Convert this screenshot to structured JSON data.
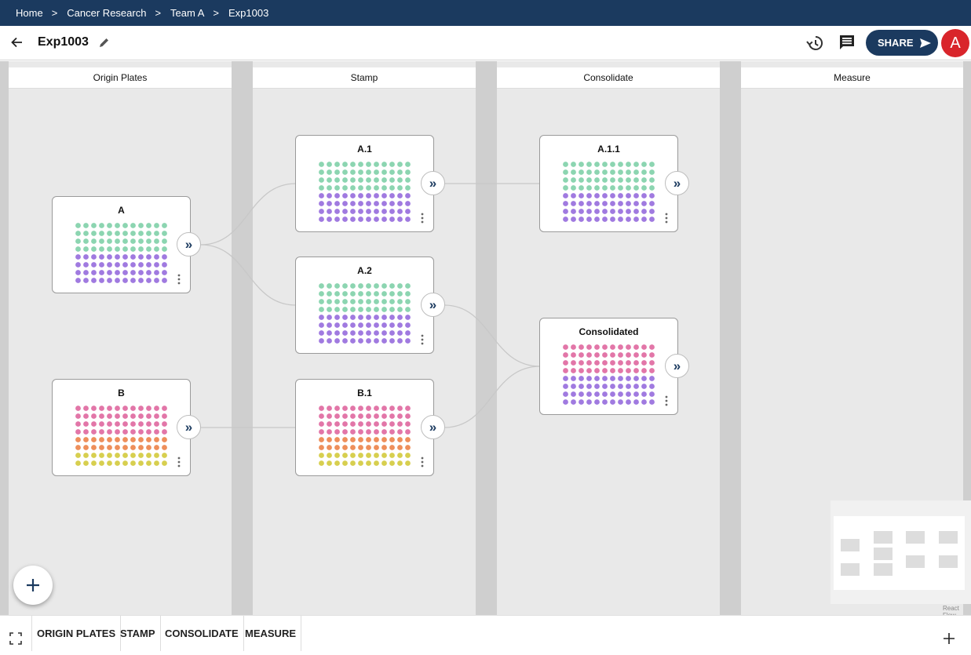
{
  "breadcrumb": [
    "Home",
    "Cancer Research",
    "Team A",
    "Exp1003"
  ],
  "header": {
    "title": "Exp1003",
    "share_label": "SHARE",
    "avatar_initial": "A"
  },
  "lanes": [
    "Origin Plates",
    "Stamp",
    "Consolidate",
    "Measure"
  ],
  "nodes": {
    "a": "A",
    "b": "B",
    "a1": "A.1",
    "a2": "A.2",
    "b1": "B.1",
    "a11": "A.1.1",
    "cons": "Consolidated"
  },
  "expand_glyph": "»",
  "minimap_attribution": "React Flow",
  "bottom_tabs": [
    "ORIGIN PLATES",
    "STAMP",
    "CONSOLIDATE",
    "MEASURE"
  ],
  "colors": {
    "navy": "#1b3a5f",
    "green": "#8cd5b1",
    "purple": "#a07ae0",
    "pink": "#e276a8",
    "orange": "#ee8f5b",
    "yellow": "#d7cf4f",
    "avatar": "#d9252b"
  },
  "icons": [
    "back-arrow-icon",
    "pencil-icon",
    "history-icon",
    "comment-icon",
    "send-icon",
    "kebab-icon",
    "fit-view-icon",
    "plus-icon"
  ]
}
